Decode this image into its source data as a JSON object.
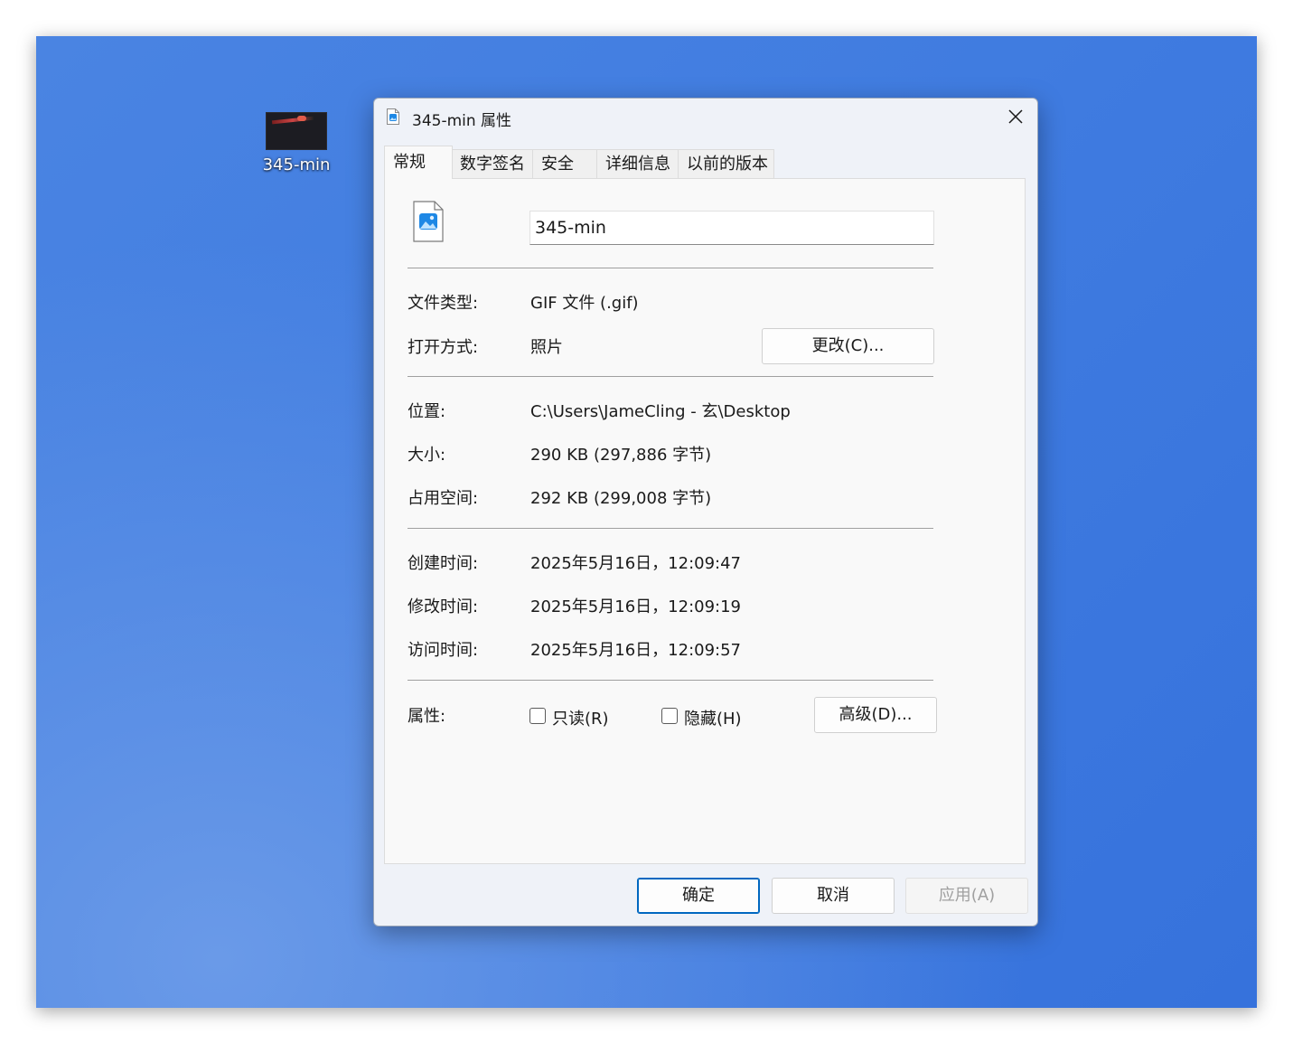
{
  "desktop": {
    "icon_label": "345-min"
  },
  "dialog": {
    "title": "345-min 属性",
    "tabs": [
      {
        "label": "常规"
      },
      {
        "label": "数字签名"
      },
      {
        "label": "安全"
      },
      {
        "label": "详细信息"
      },
      {
        "label": "以前的版本"
      }
    ],
    "active_tab": "常规",
    "file_name_value": "345-min",
    "rows": {
      "file_type": {
        "label": "文件类型:",
        "value": "GIF 文件 (.gif)"
      },
      "open_with": {
        "label": "打开方式:",
        "value": "照片",
        "change_button": "更改(C)..."
      },
      "location": {
        "label": "位置:",
        "value": "C:\\Users\\JameCling - 玄\\Desktop"
      },
      "size": {
        "label": "大小:",
        "value": "290 KB (297,886 字节)"
      },
      "size_on_disk": {
        "label": "占用空间:",
        "value": "292 KB (299,008 字节)"
      },
      "created": {
        "label": "创建时间:",
        "value": "2025年5月16日，12:09:47"
      },
      "modified": {
        "label": "修改时间:",
        "value": "2025年5月16日，12:09:19"
      },
      "accessed": {
        "label": "访问时间:",
        "value": "2025年5月16日，12:09:57"
      }
    },
    "attributes": {
      "label": "属性:",
      "readonly_label": "只读(R)",
      "readonly_checked": false,
      "hidden_label": "隐藏(H)",
      "hidden_checked": false,
      "advanced_button": "高级(D)..."
    },
    "footer": {
      "ok": "确定",
      "cancel": "取消",
      "apply": "应用(A)"
    }
  }
}
